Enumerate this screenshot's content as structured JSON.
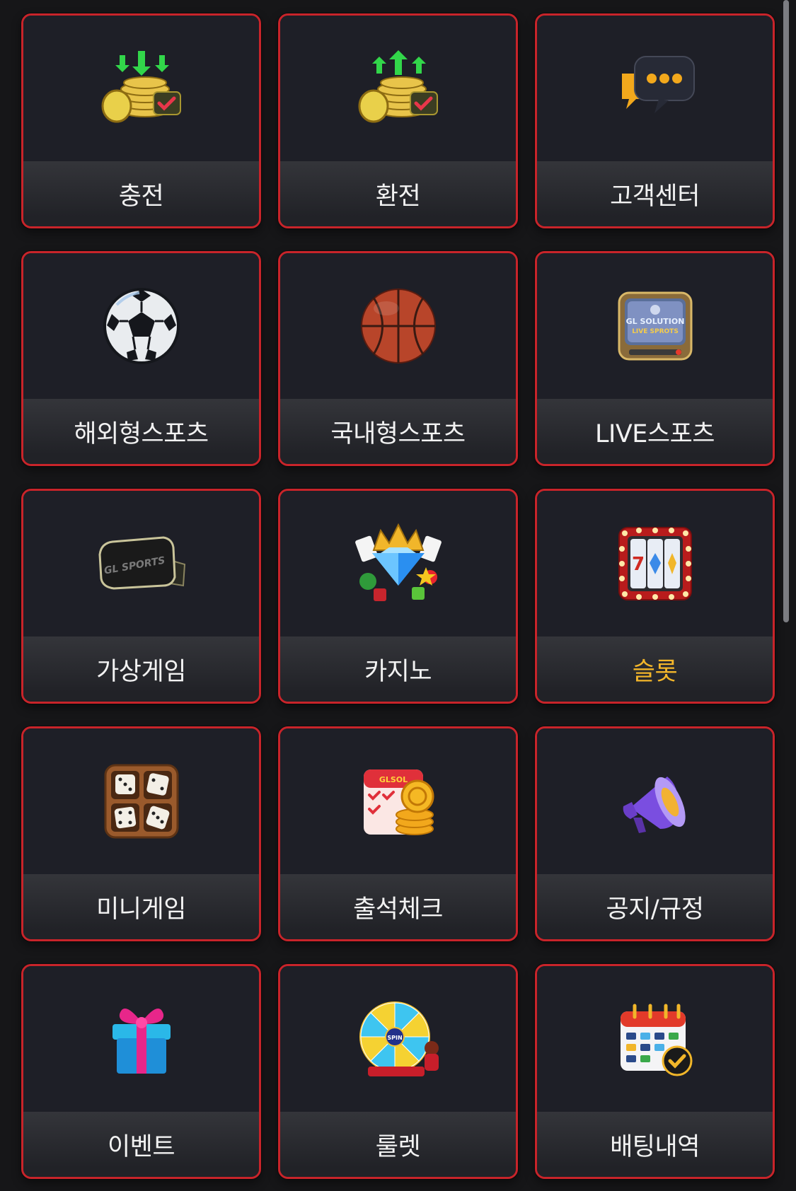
{
  "menu": {
    "accent_border": "#c8242a",
    "active_label_color": "#f3b62a",
    "items": [
      {
        "label": "충전",
        "icon": "coins-deposit-icon"
      },
      {
        "label": "환전",
        "icon": "coins-withdraw-icon"
      },
      {
        "label": "고객센터",
        "icon": "chat-bubble-icon"
      },
      {
        "label": "해외형스포츠",
        "icon": "soccer-ball-icon"
      },
      {
        "label": "국내형스포츠",
        "icon": "basketball-icon"
      },
      {
        "label": "LIVE스포츠",
        "icon": "live-tv-icon",
        "tv_text_1": "GL SOLUTION",
        "tv_text_2": "LIVE SPROTS"
      },
      {
        "label": "가상게임",
        "icon": "vr-headset-icon",
        "headset_text": "GL SPORTS"
      },
      {
        "label": "카지노",
        "icon": "casino-crown-diamond-icon"
      },
      {
        "label": "슬롯",
        "icon": "slot-machine-icon",
        "active": true
      },
      {
        "label": "미니게임",
        "icon": "dice-box-icon"
      },
      {
        "label": "출석체크",
        "icon": "attendance-calendar-icon",
        "calendar_text": "GLSOL"
      },
      {
        "label": "공지/규정",
        "icon": "megaphone-icon"
      },
      {
        "label": "이벤트",
        "icon": "gift-box-icon"
      },
      {
        "label": "룰렛",
        "icon": "roulette-wheel-icon",
        "wheel_text": "SPIN"
      },
      {
        "label": "배팅내역",
        "icon": "betting-calendar-icon"
      }
    ]
  }
}
